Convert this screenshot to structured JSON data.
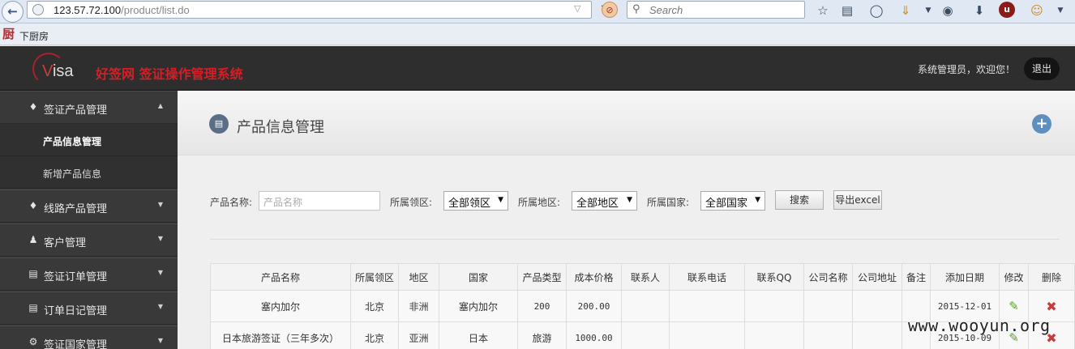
{
  "browser": {
    "url_host": "123.57.72.100",
    "url_path": "/product/list.do",
    "search_placeholder": "Search",
    "bookmark_label": "下厨房",
    "bookmark_icon": "厨"
  },
  "header": {
    "logo_v": "V",
    "logo_rest": "isa",
    "system_title": "好签网 签证操作管理系统",
    "welcome": "系统管理员，欢迎您！",
    "logout_label": "退出"
  },
  "sidebar": {
    "groups": [
      {
        "label": "签证产品管理",
        "icon": "tag-icon"
      },
      {
        "label": "线路产品管理",
        "icon": "tag-icon"
      },
      {
        "label": "客户管理",
        "icon": "users-icon"
      },
      {
        "label": "签证订单管理",
        "icon": "clipboard-icon"
      },
      {
        "label": "订单日记管理",
        "icon": "clipboard-icon"
      },
      {
        "label": "签证国家管理",
        "icon": "gear-icon"
      }
    ],
    "sub_items": [
      {
        "label": "产品信息管理",
        "active": true
      },
      {
        "label": "新增产品信息",
        "active": false
      }
    ]
  },
  "page": {
    "title": "产品信息管理"
  },
  "filters": {
    "name_label": "产品名称:",
    "name_placeholder": "产品名称",
    "region_label": "所属领区:",
    "region_value": "全部领区",
    "area_label": "所属地区:",
    "area_value": "全部地区",
    "country_label": "所属国家:",
    "country_value": "全部国家",
    "search_label": "搜索",
    "export_label": "导出excel"
  },
  "table": {
    "headers": [
      "产品名称",
      "所属领区",
      "地区",
      "国家",
      "产品类型",
      "成本价格",
      "联系人",
      "联系电话",
      "联系QQ",
      "公司名称",
      "公司地址",
      "备注",
      "添加日期",
      "修改",
      "删除"
    ],
    "rows": [
      {
        "name": "塞内加尔",
        "region": "北京",
        "area": "非洲",
        "country": "塞内加尔",
        "type": "200",
        "price": "200.00",
        "contact": "",
        "phone": "",
        "qq": "",
        "company": "",
        "address": "",
        "note": "",
        "date": "2015-12-01"
      },
      {
        "name": "日本旅游签证（三年多次）",
        "region": "北京",
        "area": "亚洲",
        "country": "日本",
        "type": "旅游",
        "price": "1000.00",
        "contact": "",
        "phone": "",
        "qq": "",
        "company": "",
        "address": "",
        "note": "",
        "date": "2015-10-09"
      }
    ]
  },
  "watermark": "www.wooyun.org",
  "colors": {
    "header_bg": "#2e2e2e",
    "sidebar_bg": "#3a3a3a",
    "title_red": "#d51e25",
    "edit_green": "#5aa02c",
    "delete_red": "#c83b3b"
  }
}
